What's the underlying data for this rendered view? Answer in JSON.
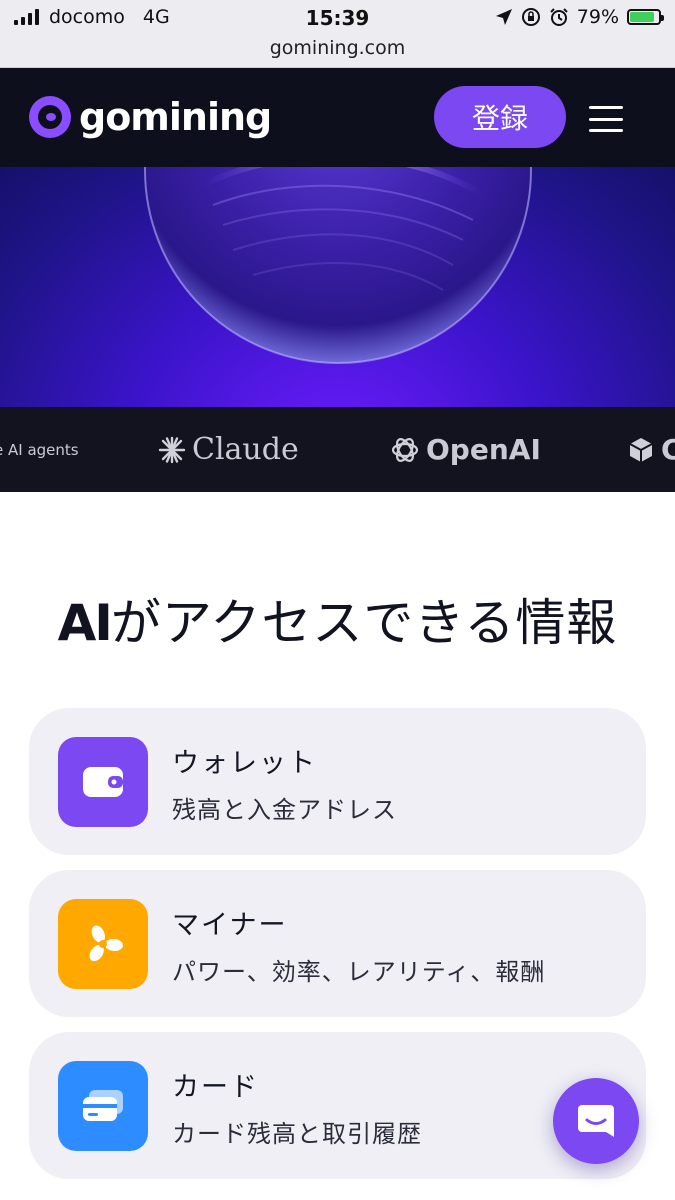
{
  "status_bar": {
    "carrier": "docomo",
    "network": "4G",
    "time": "15:39",
    "url": "gomining.com",
    "battery": "79%"
  },
  "header": {
    "logo_text": "gomining",
    "register_label": "登録",
    "menu_icon": "hamburger-menu-icon"
  },
  "partners": {
    "agents_label": "e AI agents",
    "claude": "Claude",
    "openai": "OpenAI",
    "next": "C"
  },
  "main": {
    "title_ai": "AI",
    "title_rest": "がアクセスできる情報",
    "cards": [
      {
        "icon": "wallet-icon",
        "color": "#7b48f2",
        "title": "ウォレット",
        "desc": "残高と入金アドレス"
      },
      {
        "icon": "fan-icon",
        "color": "#ffa800",
        "title": "マイナー",
        "desc": "パワー、効率、レアリティ、報酬"
      },
      {
        "icon": "cards-icon",
        "color": "#2d8cff",
        "title": "カード",
        "desc": "カード残高と取引履歴"
      }
    ]
  },
  "chat": {
    "icon": "chat-icon"
  },
  "colors": {
    "accent": "#7b48f2",
    "nav_bg": "#0e0f1d",
    "card_bg": "#efeff5"
  }
}
